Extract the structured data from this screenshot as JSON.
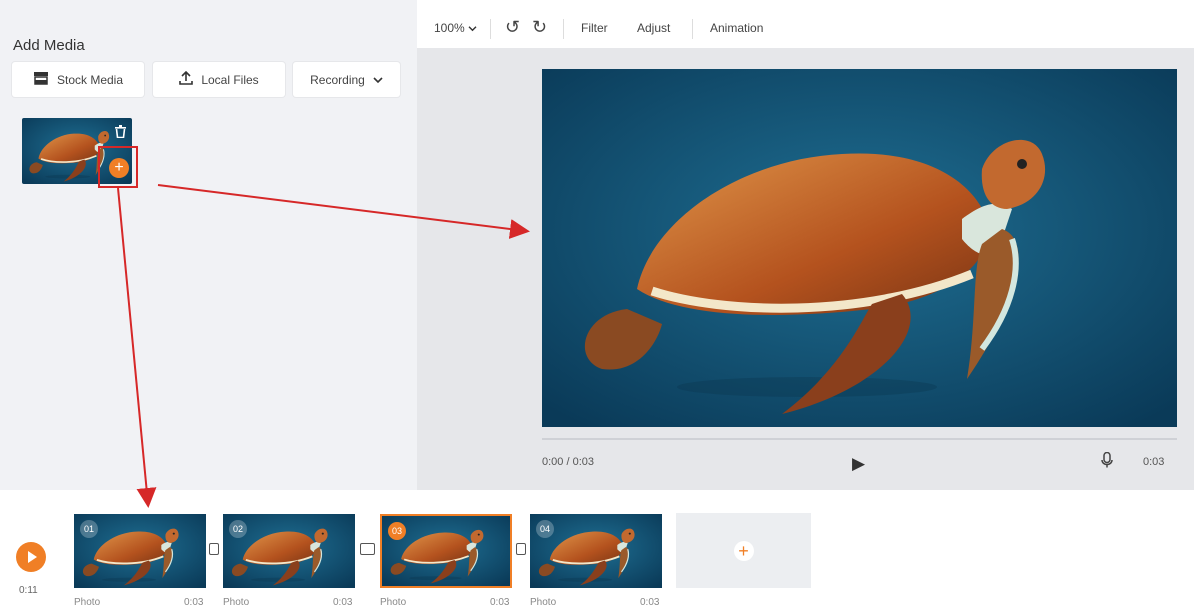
{
  "left_panel": {
    "title": "Add Media",
    "buttons": {
      "stock": "Stock Media",
      "local": "Local Files",
      "recording": "Recording"
    }
  },
  "toolbar": {
    "zoom": "100%",
    "tabs": [
      "Filter",
      "Adjust",
      "Animation"
    ]
  },
  "preview": {
    "time": "0:00 / 0:03",
    "end_time": "0:03"
  },
  "timeline": {
    "total_duration": "0:11",
    "clips": [
      {
        "num": "01",
        "label": "Photo",
        "duration": "0:03"
      },
      {
        "num": "02",
        "label": "Photo",
        "duration": "0:03"
      },
      {
        "num": "03",
        "label": "Photo",
        "duration": "0:03"
      },
      {
        "num": "04",
        "label": "Photo",
        "duration": "0:03"
      }
    ],
    "selected_clip": 3
  },
  "colors": {
    "accent": "#f07f26",
    "highlight": "#d62828",
    "ocean": "#0f4a6b"
  }
}
